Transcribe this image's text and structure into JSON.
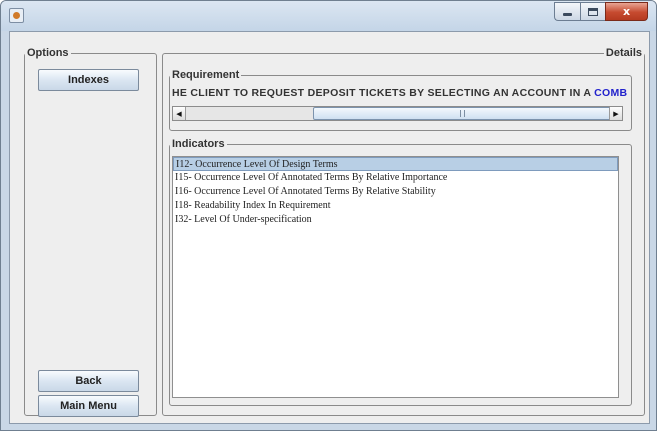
{
  "window": {
    "controls": {
      "minimize": "minimize",
      "maximize": "maximize",
      "close": "x"
    }
  },
  "options": {
    "legend": "Options",
    "buttons": {
      "indexes": "Indexes",
      "back": "Back",
      "main_menu": "Main Menu"
    }
  },
  "details": {
    "legend": "Details",
    "requirement": {
      "legend": "Requirement",
      "text_prefix": "HE CLIENT TO REQUEST DEPOSIT TICKETS BY SELECTING AN ACCOUNT IN A ",
      "text_highlight": "COMBO BOX",
      "highlight_color": "#2222cc"
    },
    "indicators": {
      "legend": "Indicators",
      "items": [
        {
          "label": "I12- Occurrence Level Of Design Terms",
          "selected": true
        },
        {
          "label": "I15- Occurrence Level Of Annotated Terms By Relative Importance",
          "selected": false
        },
        {
          "label": "I16- Occurrence Level Of Annotated Terms By Relative Stability",
          "selected": false
        },
        {
          "label": "I18- Readability Index In Requirement",
          "selected": false
        },
        {
          "label": "I32- Level Of Under-specification",
          "selected": false
        }
      ]
    }
  },
  "icons": [
    "app-icon",
    "minimize-icon",
    "maximize-icon",
    "close-icon",
    "scroll-left-icon",
    "scroll-right-icon"
  ]
}
